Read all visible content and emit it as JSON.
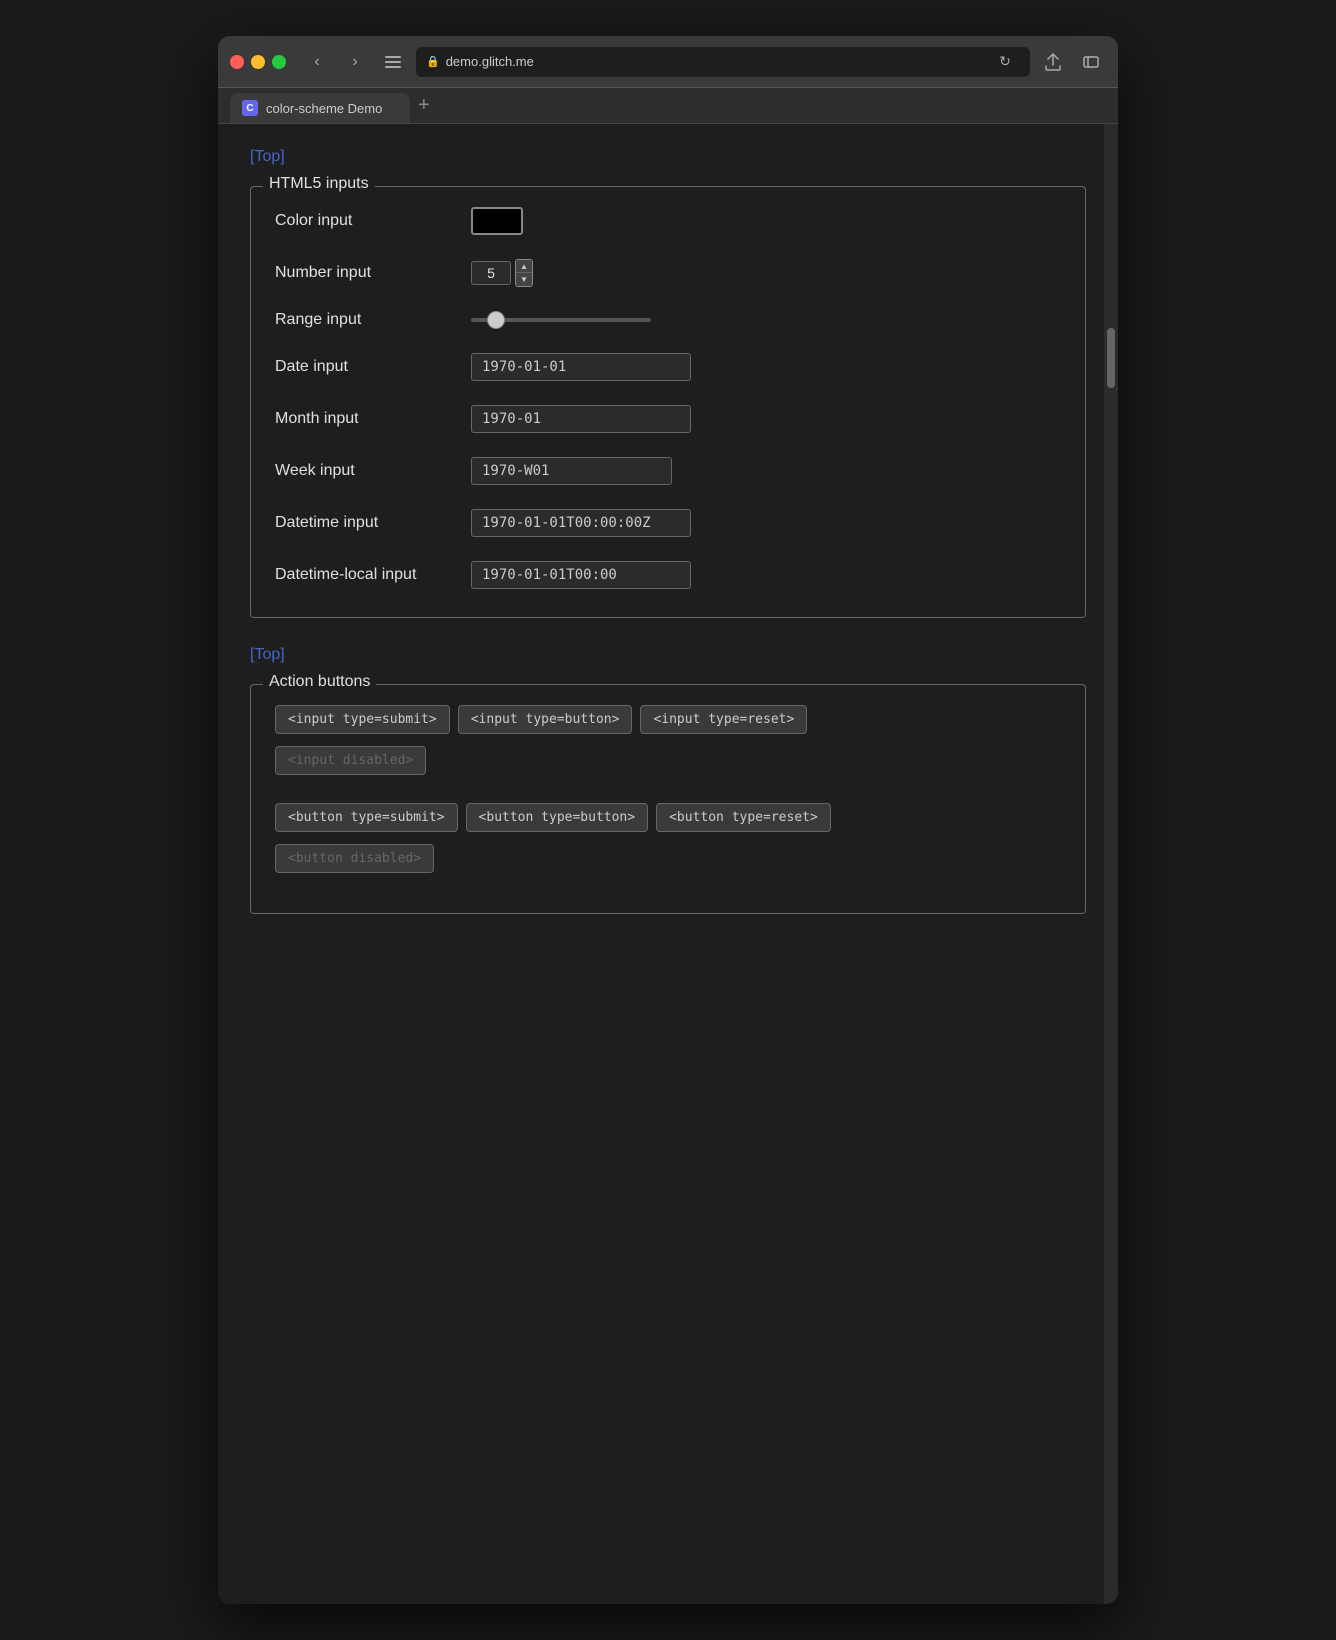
{
  "browser": {
    "url": "demo.glitch.me",
    "tab_title": "color-scheme Demo",
    "tab_favicon": "C"
  },
  "nav": {
    "back": "‹",
    "forward": "›",
    "sidebar": "⊟",
    "menu": "≡",
    "reload": "↻",
    "share": "↑",
    "newwindow": "⧉",
    "new_tab": "+"
  },
  "page": {
    "top_link_1": "[Top]",
    "top_link_2": "[Top]",
    "html5_legend": "HTML5 inputs",
    "action_legend": "Action buttons",
    "inputs": {
      "color_label": "Color input",
      "color_value": "#000000",
      "number_label": "Number input",
      "number_value": "5",
      "range_label": "Range input",
      "range_value": "10",
      "date_label": "Date input",
      "date_value": "1970-01-01",
      "month_label": "Month input",
      "month_value": "1970-01",
      "week_label": "Week input",
      "week_value": "1970-W01",
      "datetime_label": "Datetime input",
      "datetime_value": "1970-01-01T00:00:00Z",
      "datetime_local_label": "Datetime-local input",
      "datetime_local_value": "1970-01-01T00:00"
    },
    "buttons": {
      "input_submit": "<input type=submit>",
      "input_button": "<input type=button>",
      "input_reset": "<input type=reset>",
      "input_disabled": "<input disabled>",
      "button_submit": "<button type=submit>",
      "button_button": "<button type=button>",
      "button_reset": "<button type=reset>",
      "button_disabled": "<button disabled>"
    }
  }
}
